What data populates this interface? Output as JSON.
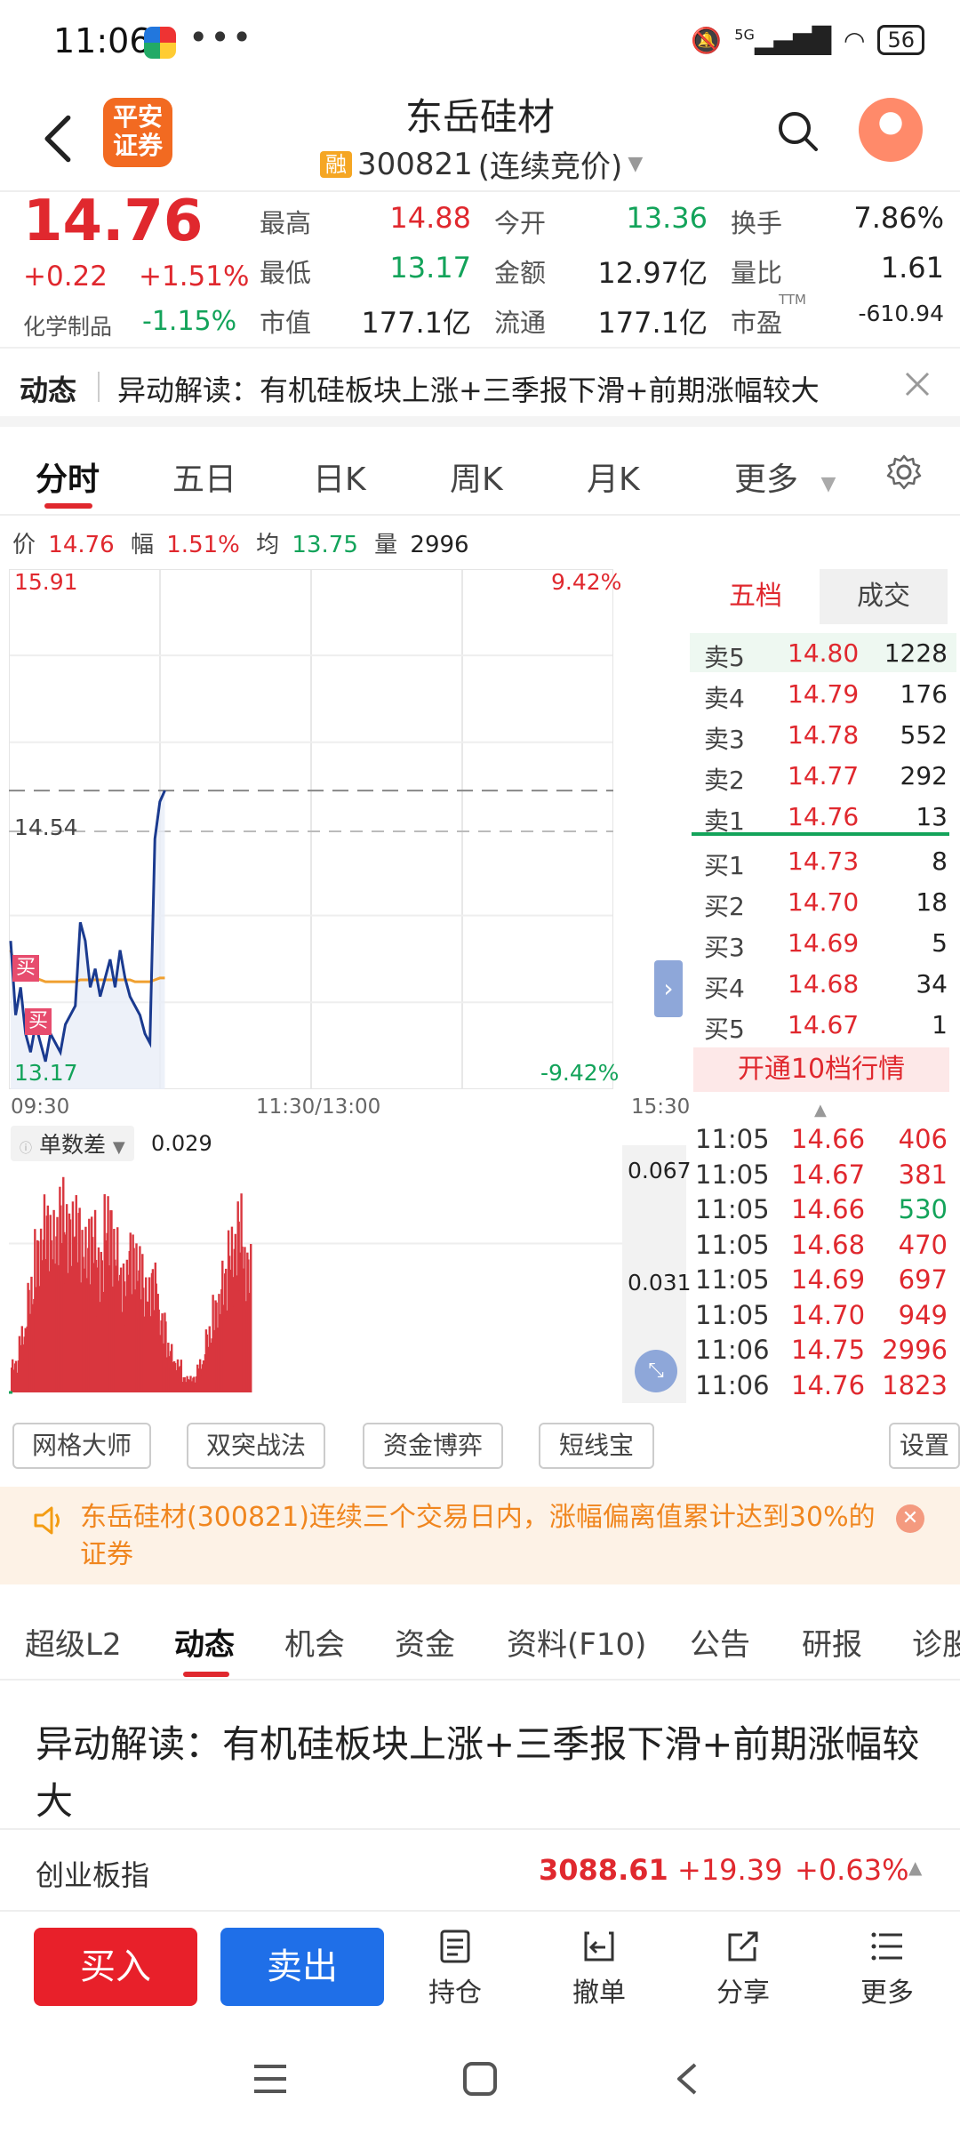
{
  "status_bar": {
    "time": "11:06",
    "dots": "•••",
    "signal": "5G",
    "battery": "56"
  },
  "header": {
    "logo_line1": "平安",
    "logo_line2": "证券",
    "stock_name": "东岳硅材",
    "badge": "融",
    "stock_code": "300821",
    "trade_status": "(连续竞价)"
  },
  "quote": {
    "price": "14.76",
    "change": "+0.22",
    "change_pct": "+1.51%",
    "sector": "化学制品",
    "sector_pct": "-1.15%",
    "stats": [
      {
        "label": "最高",
        "value": "14.88",
        "color": "red"
      },
      {
        "label": "今开",
        "value": "13.36",
        "color": "green"
      },
      {
        "label": "换手",
        "value": "7.86%",
        "color": "black"
      },
      {
        "label": "最低",
        "value": "13.17",
        "color": "green"
      },
      {
        "label": "金额",
        "value": "12.97亿",
        "color": "black"
      },
      {
        "label": "量比",
        "value": "1.61",
        "color": "black"
      },
      {
        "label": "市值",
        "value": "177.1亿",
        "color": "black"
      },
      {
        "label": "流通",
        "value": "177.1亿",
        "color": "black"
      },
      {
        "label": "市盈",
        "value": "-610.94",
        "color": "black",
        "sup": "TTM"
      }
    ]
  },
  "news_strip": {
    "tag": "动态",
    "text": "异动解读：有机硅板块上涨+三季报下滑+前期涨幅较大"
  },
  "chart_tabs": [
    {
      "label": "分时",
      "active": true
    },
    {
      "label": "五日",
      "active": false
    },
    {
      "label": "日K",
      "active": false
    },
    {
      "label": "周K",
      "active": false
    },
    {
      "label": "月K",
      "active": false
    },
    {
      "label": "更多",
      "active": false
    }
  ],
  "chart_info": {
    "price_label": "价",
    "price": "14.76",
    "amp_label": "幅",
    "amp": "1.51%",
    "avg_label": "均",
    "avg": "13.75",
    "vol_label": "量",
    "vol": "2996"
  },
  "chart_labels": {
    "top_price": "15.91",
    "top_pct": "9.42%",
    "mid_price": "14.54",
    "bot_price": "13.17",
    "bot_pct": "-9.42%",
    "t_start": "09:30",
    "t_mid": "11:30/13:00",
    "t_end": "15:30",
    "buy_marker": "买"
  },
  "order_book": {
    "tab_five": "五档",
    "tab_deal": "成交",
    "sells": [
      {
        "label": "卖5",
        "price": "14.80",
        "vol": "1228"
      },
      {
        "label": "卖4",
        "price": "14.79",
        "vol": "176"
      },
      {
        "label": "卖3",
        "price": "14.78",
        "vol": "552"
      },
      {
        "label": "卖2",
        "price": "14.77",
        "vol": "292"
      },
      {
        "label": "卖1",
        "price": "14.76",
        "vol": "13"
      }
    ],
    "buys": [
      {
        "label": "买1",
        "price": "14.73",
        "vol": "8"
      },
      {
        "label": "买2",
        "price": "14.70",
        "vol": "18"
      },
      {
        "label": "买3",
        "price": "14.69",
        "vol": "5"
      },
      {
        "label": "买4",
        "price": "14.68",
        "vol": "34"
      },
      {
        "label": "买5",
        "price": "14.67",
        "vol": "1"
      }
    ],
    "upgrade": "开通10档行情"
  },
  "indicator": {
    "name": "单数差",
    "value": "0.029",
    "y_top": "0.067",
    "y_mid": "0.031"
  },
  "ticks": [
    {
      "time": "11:05",
      "price": "14.66",
      "vol": "406",
      "vc": "red"
    },
    {
      "time": "11:05",
      "price": "14.67",
      "vol": "381",
      "vc": "red"
    },
    {
      "time": "11:05",
      "price": "14.66",
      "vol": "530",
      "vc": "green"
    },
    {
      "time": "11:05",
      "price": "14.68",
      "vol": "470",
      "vc": "red"
    },
    {
      "time": "11:05",
      "price": "14.69",
      "vol": "697",
      "vc": "red"
    },
    {
      "time": "11:05",
      "price": "14.70",
      "vol": "949",
      "vc": "red"
    },
    {
      "time": "11:06",
      "price": "14.75",
      "vol": "2996",
      "vc": "red"
    },
    {
      "time": "11:06",
      "price": "14.76",
      "vol": "1823",
      "vc": "red"
    }
  ],
  "tools": [
    "网格大师",
    "双突战法",
    "资金博弈",
    "短线宝",
    "设置"
  ],
  "alert": {
    "text": "东岳硅材(300821)连续三个交易日内，涨幅偏离值累计达到30%的证券"
  },
  "sub_tabs": [
    {
      "label": "超级L2",
      "active": false
    },
    {
      "label": "动态",
      "active": true
    },
    {
      "label": "机会",
      "active": false
    },
    {
      "label": "资金",
      "active": false
    },
    {
      "label": "资料(F10)",
      "active": false
    },
    {
      "label": "公告",
      "active": false
    },
    {
      "label": "研报",
      "active": false
    },
    {
      "label": "诊股",
      "active": false
    }
  ],
  "news_title": "异动解读：有机硅板块上涨+三季报下滑+前期涨幅较大",
  "index_bar": {
    "name": "创业板指",
    "value": "3088.61",
    "change": "+19.39",
    "pct": "+0.63%"
  },
  "bottom_bar": {
    "buy": "买入",
    "sell": "卖出",
    "hold": "持仓",
    "cancel": "撤单",
    "share": "分享",
    "more": "更多"
  },
  "chart_data": {
    "type": "line",
    "title": "",
    "series": [
      {
        "values": [
          13.95,
          13.55,
          13.7,
          13.45,
          13.35,
          13.5,
          13.4,
          13.3,
          13.45,
          13.4,
          13.35,
          13.5,
          13.55,
          13.6,
          14.05,
          13.95,
          13.7,
          13.8,
          13.65,
          13.75,
          13.85,
          13.7,
          13.9,
          13.75,
          13.65,
          13.6,
          13.55,
          13.45,
          13.4,
          14.5,
          14.7,
          14.76
        ]
      },
      {
        "values": [
          13.9,
          13.8,
          13.78,
          13.76,
          13.75,
          13.75,
          13.74,
          13.73,
          13.73,
          13.73,
          13.73,
          13.73,
          13.73,
          13.73,
          13.74,
          13.74,
          13.74,
          13.74,
          13.74,
          13.74,
          13.74,
          13.74,
          13.74,
          13.74,
          13.74,
          13.73,
          13.73,
          13.73,
          13.73,
          13.74,
          13.75,
          13.75
        ]
      }
    ],
    "ylim": [
      13.17,
      15.91
    ],
    "reference": 14.54,
    "indicator_bars": [
      0.01,
      0.02,
      0.035,
      0.05,
      0.06,
      0.055,
      0.065,
      0.058,
      0.06,
      0.05,
      0.055,
      0.045,
      0.06,
      0.05,
      0.04,
      0.05,
      0.045,
      0.035,
      0.04,
      0.025,
      0.015,
      0.01,
      0.005,
      0.005,
      0.01,
      0.02,
      0.03,
      0.04,
      0.05,
      0.06,
      0.045
    ]
  }
}
